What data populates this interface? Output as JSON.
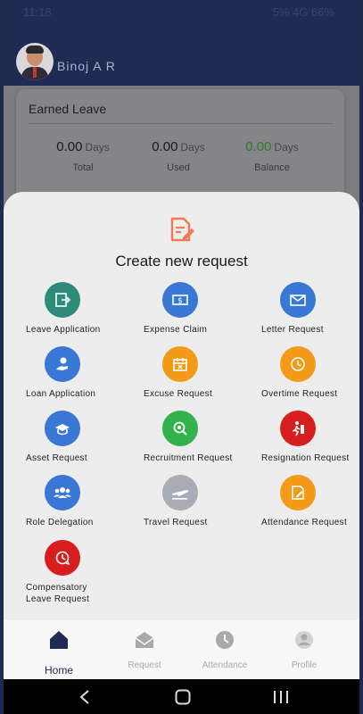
{
  "status": {
    "time": "11:18",
    "right": "5% 4G 66%"
  },
  "user": {
    "name": "Binoj A R"
  },
  "leave": {
    "title": "Earned Leave",
    "stats": [
      {
        "value": "0.00",
        "unit": "Days",
        "label": "Total"
      },
      {
        "value": "0.00",
        "unit": "Days",
        "label": "Used"
      },
      {
        "value": "0.00",
        "unit": "Days",
        "label": "Balance"
      }
    ]
  },
  "sheet": {
    "title": "Create new request",
    "items": [
      {
        "label": "Leave Application",
        "icon": "exit-icon",
        "color": "#2e8b7a"
      },
      {
        "label": "Expense Claim",
        "icon": "dollar-bill-icon",
        "color": "#3a78d6"
      },
      {
        "label": "Letter Request",
        "icon": "envelope-icon",
        "color": "#3a78d6"
      },
      {
        "label": "Loan Application",
        "icon": "hand-money-icon",
        "color": "#3a78d6"
      },
      {
        "label": "Excuse Request",
        "icon": "calendar-icon",
        "color": "#f39b19"
      },
      {
        "label": "Overtime Request",
        "icon": "clock-icon",
        "color": "#f39b19"
      },
      {
        "label": "Asset Request",
        "icon": "asset-icon",
        "color": "#3a78d6"
      },
      {
        "label": "Recruitment Request",
        "icon": "recruit-icon",
        "color": "#31b24a"
      },
      {
        "label": "Resignation Request",
        "icon": "exit-person-icon",
        "color": "#d71e1e"
      },
      {
        "label": "Role Delegation",
        "icon": "group-icon",
        "color": "#3a78d6"
      },
      {
        "label": "Travel Request",
        "icon": "airplane-icon",
        "color": "#a9acb6"
      },
      {
        "label": "Attendance Request",
        "icon": "doc-edit-icon",
        "color": "#f39b19"
      },
      {
        "label": "Compensatory Leave Request",
        "icon": "clock-refresh-icon",
        "color": "#d71e1e"
      }
    ]
  },
  "nav": [
    {
      "label": "Home",
      "icon": "home-icon"
    },
    {
      "label": "Request",
      "icon": "envelope-open-icon"
    },
    {
      "label": "Attendance",
      "icon": "clock-icon"
    },
    {
      "label": "Profile",
      "icon": "person-icon"
    }
  ]
}
